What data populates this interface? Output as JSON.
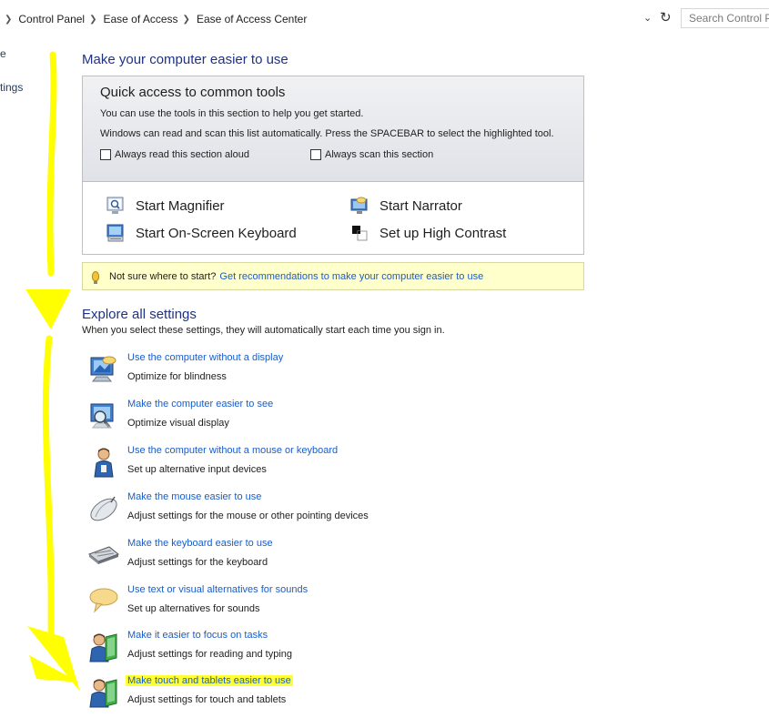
{
  "address_bar": {
    "breadcrumbs": [
      "Control Panel",
      "Ease of Access",
      "Ease of Access Center"
    ],
    "search_placeholder": "Search Control Panel"
  },
  "left_nav": {
    "items": [
      "e",
      "tings"
    ]
  },
  "main": {
    "title": "Make your computer easier to use",
    "quick_access": {
      "heading": "Quick access to common tools",
      "desc1": "You can use the tools in this section to help you get started.",
      "desc2": "Windows can read and scan this list automatically.  Press the SPACEBAR to select the highlighted tool.",
      "checkbox_read": "Always read this section aloud",
      "checkbox_scan": "Always scan this section",
      "tools": [
        {
          "label": "Start Magnifier",
          "icon": "magnifier-icon"
        },
        {
          "label": "Start Narrator",
          "icon": "narrator-icon"
        },
        {
          "label": "Start On-Screen Keyboard",
          "icon": "onscreen-keyboard-icon"
        },
        {
          "label": "Set up High Contrast",
          "icon": "high-contrast-icon"
        }
      ]
    },
    "tip": {
      "text": "Not sure where to start?",
      "link": "Get recommendations to make your computer easier to use"
    },
    "explore": {
      "title": "Explore all settings",
      "subtitle": "When you select these settings, they will automatically start each time you sign in.",
      "items": [
        {
          "link": "Use the computer without a display",
          "desc": "Optimize for blindness",
          "icon": "monitor-speech-icon"
        },
        {
          "link": "Make the computer easier to see",
          "desc": "Optimize visual display",
          "icon": "monitor-magnifier-icon"
        },
        {
          "link": "Use the computer without a mouse or keyboard",
          "desc": "Set up alternative input devices",
          "icon": "person-icon"
        },
        {
          "link": "Make the mouse easier to use",
          "desc": "Adjust settings for the mouse or other pointing devices",
          "icon": "mouse-icon"
        },
        {
          "link": "Make the keyboard easier to use",
          "desc": "Adjust settings for the keyboard",
          "icon": "keyboard-icon"
        },
        {
          "link": "Use text or visual alternatives for sounds",
          "desc": "Set up alternatives for sounds",
          "icon": "speech-bubble-icon"
        },
        {
          "link": "Make it easier to focus on tasks",
          "desc": "Adjust settings for reading and typing",
          "icon": "person-book-icon"
        },
        {
          "link": "Make touch and tablets easier to use",
          "desc": "Adjust settings for touch and tablets",
          "icon": "person-book-icon",
          "highlighted": true
        }
      ]
    }
  },
  "colors": {
    "link": "#1a5dc8",
    "title": "#1e3287",
    "tip_background": "#ffffcc",
    "annotation_highlight": "#ffff00"
  }
}
